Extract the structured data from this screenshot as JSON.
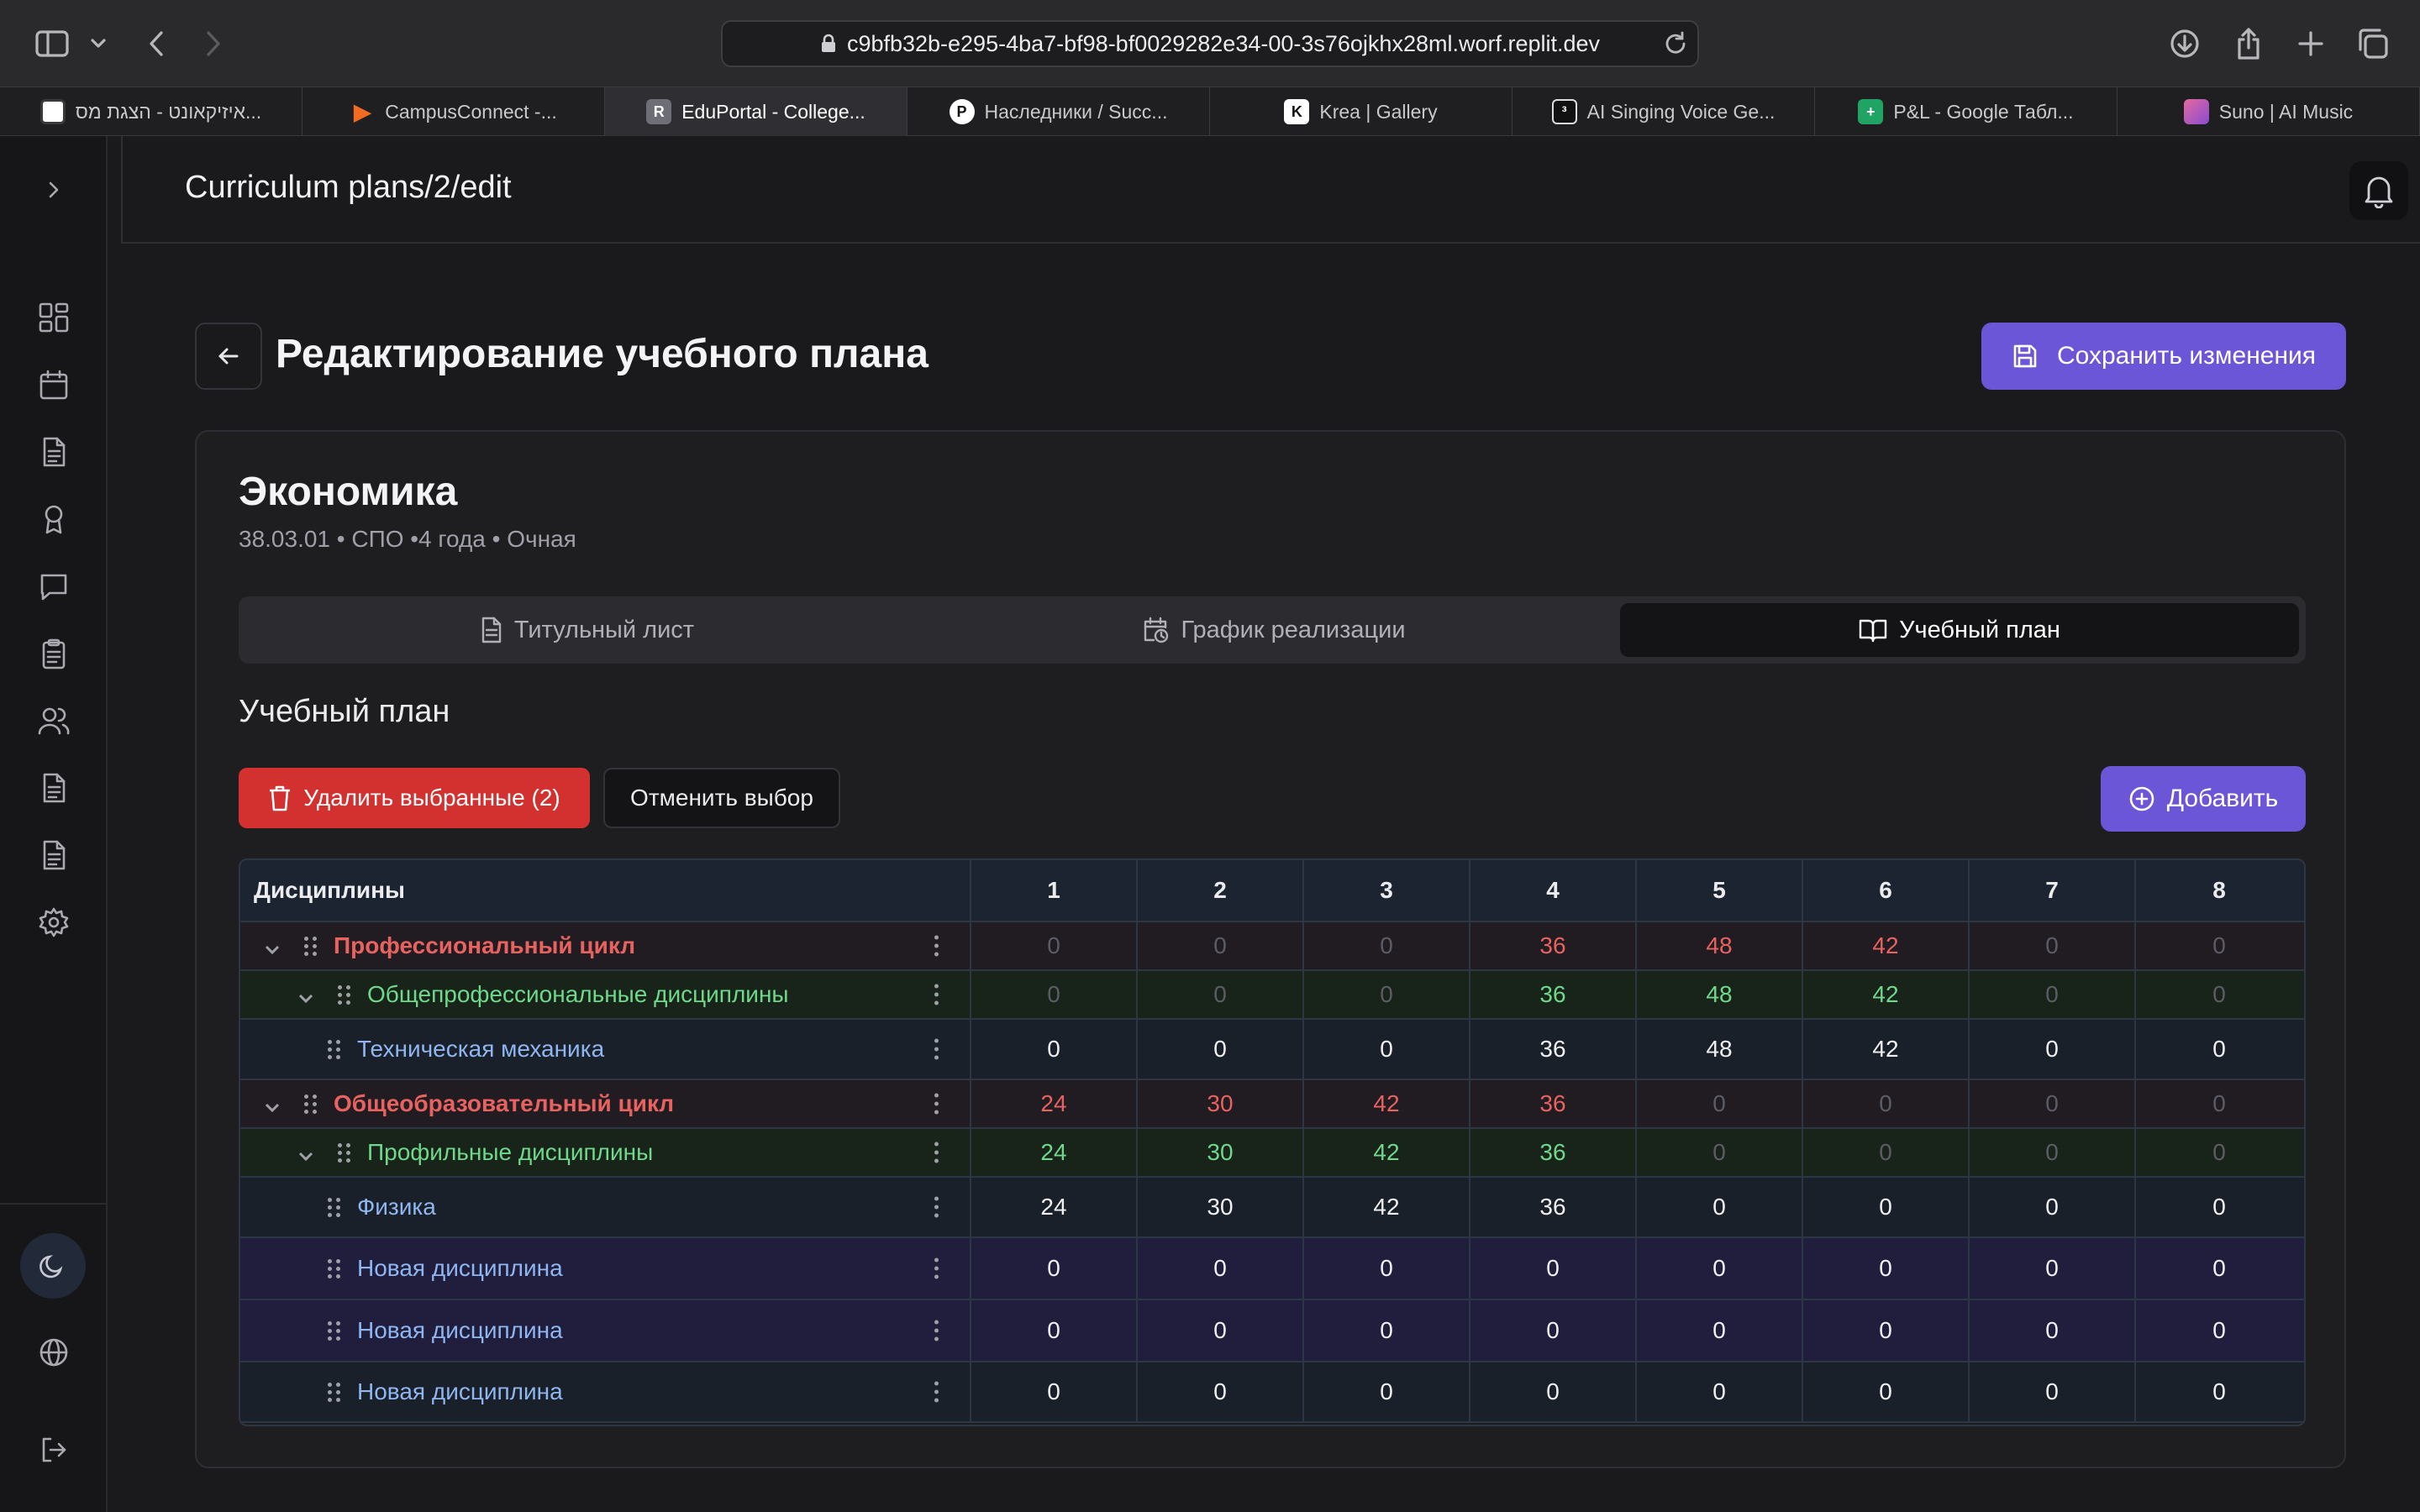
{
  "browser": {
    "url": "c9bfb32b-e295-4ba7-bf98-bf0029282e34-00-3s76ojkhx28ml.worf.replit.dev",
    "tabs": [
      {
        "label": "איזיקאונט - הצגת מס...",
        "favicon_color": "#ffffff",
        "favicon_text": ""
      },
      {
        "label": "CampusConnect -...",
        "favicon_color": "#f26b21",
        "favicon_text": ""
      },
      {
        "label": "EduPortal - College...",
        "favicon_color": "#6e6e76",
        "favicon_text": "R"
      },
      {
        "label": "Наследники / Succ...",
        "favicon_color": "#ffffff",
        "favicon_text": "P"
      },
      {
        "label": "Krea | Gallery",
        "favicon_color": "#ffffff",
        "favicon_text": "K"
      },
      {
        "label": "AI Singing Voice Ge...",
        "favicon_color": "#111111",
        "favicon_text": "³"
      },
      {
        "label": "P&L - Google Табл...",
        "favicon_color": "#1fa463",
        "favicon_text": "+"
      },
      {
        "label": "Suno | AI Music",
        "favicon_color": "#e46aa0",
        "favicon_text": ""
      }
    ]
  },
  "header": {
    "title": "Curriculum plans/2/edit"
  },
  "page": {
    "title": "Редактирование учебного плана",
    "save_label": "Сохранить изменения"
  },
  "program": {
    "name": "Экономика",
    "meta": "38.03.01 • СПО •4 года • Очная"
  },
  "tabs": [
    {
      "label": "Титульный лист",
      "icon": "file-icon"
    },
    {
      "label": "График реализации",
      "icon": "calendar-clock-icon"
    },
    {
      "label": "Учебный план",
      "icon": "book-open-icon",
      "active": true
    }
  ],
  "plan": {
    "section_title": "Учебный план",
    "delete_label": "Удалить выбранные (2)",
    "cancel_label": "Отменить выбор",
    "add_label": "Добавить"
  },
  "table": {
    "header": "Дисциплины",
    "semesters": [
      "1",
      "2",
      "3",
      "4",
      "5",
      "6",
      "7",
      "8"
    ],
    "rows": [
      {
        "name": "Профессиональный цикл",
        "level": 0,
        "type": "cycle",
        "values": [
          "0",
          "0",
          "0",
          "36",
          "48",
          "42",
          "0",
          "0"
        ]
      },
      {
        "name": "Общепрофессиональные дисциплины",
        "level": 1,
        "type": "sub",
        "values": [
          "0",
          "0",
          "0",
          "36",
          "48",
          "42",
          "0",
          "0"
        ]
      },
      {
        "name": "Техническая механика",
        "level": 2,
        "type": "item",
        "values": [
          "0",
          "0",
          "0",
          "36",
          "48",
          "42",
          "0",
          "0"
        ]
      },
      {
        "name": "Общеобразовательный цикл",
        "level": 0,
        "type": "cycle",
        "values": [
          "24",
          "30",
          "42",
          "36",
          "0",
          "0",
          "0",
          "0"
        ]
      },
      {
        "name": "Профильные дисциплины",
        "level": 1,
        "type": "sub",
        "values": [
          "24",
          "30",
          "42",
          "36",
          "0",
          "0",
          "0",
          "0"
        ]
      },
      {
        "name": "Физика",
        "level": 2,
        "type": "item",
        "values": [
          "24",
          "30",
          "42",
          "36",
          "0",
          "0",
          "0",
          "0"
        ]
      },
      {
        "name": "Новая дисциплина",
        "level": 2,
        "type": "item",
        "selected": true,
        "values": [
          "0",
          "0",
          "0",
          "0",
          "0",
          "0",
          "0",
          "0"
        ]
      },
      {
        "name": "Новая дисциплина",
        "level": 2,
        "type": "item",
        "selected": true,
        "values": [
          "0",
          "0",
          "0",
          "0",
          "0",
          "0",
          "0",
          "0"
        ]
      },
      {
        "name": "Новая дисциплина",
        "level": 2,
        "type": "item",
        "values": [
          "0",
          "0",
          "0",
          "0",
          "0",
          "0",
          "0",
          "0"
        ]
      }
    ]
  },
  "sidebar": {
    "items": [
      "dashboard-icon",
      "calendar-icon",
      "document-icon",
      "award-icon",
      "chat-icon",
      "clipboard-icon",
      "users-icon",
      "document-icon",
      "document-icon",
      "settings-icon"
    ]
  },
  "colors": {
    "accent": "#6a56d6",
    "danger": "#d2312f",
    "cycle": "#e8625f",
    "group": "#6fd88b",
    "discipline": "#8fb6f0"
  }
}
